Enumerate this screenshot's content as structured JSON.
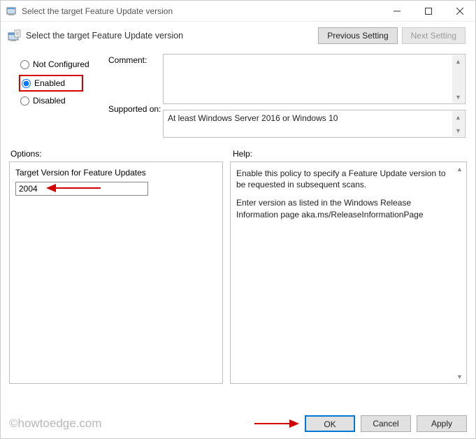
{
  "window": {
    "title": "Select the target Feature Update version"
  },
  "header": {
    "title": "Select the target Feature Update version",
    "previous_setting": "Previous Setting",
    "next_setting": "Next Setting"
  },
  "config": {
    "not_configured": "Not Configured",
    "enabled": "Enabled",
    "disabled": "Disabled",
    "selected": "enabled",
    "comment_label": "Comment:",
    "comment_value": "",
    "supported_label": "Supported on:",
    "supported_value": "At least Windows Server 2016 or Windows 10"
  },
  "lower": {
    "options_label": "Options:",
    "help_label": "Help:"
  },
  "options": {
    "target_version_label": "Target Version for Feature Updates",
    "target_version_value": "2004"
  },
  "help": {
    "p1": "Enable this policy to specify a Feature Update version to be requested in subsequent scans.",
    "p2": "Enter version as listed in the Windows Release Information page aka.ms/ReleaseInformationPage"
  },
  "buttons": {
    "ok": "OK",
    "cancel": "Cancel",
    "apply": "Apply"
  },
  "watermark": "©howtoedge.com"
}
